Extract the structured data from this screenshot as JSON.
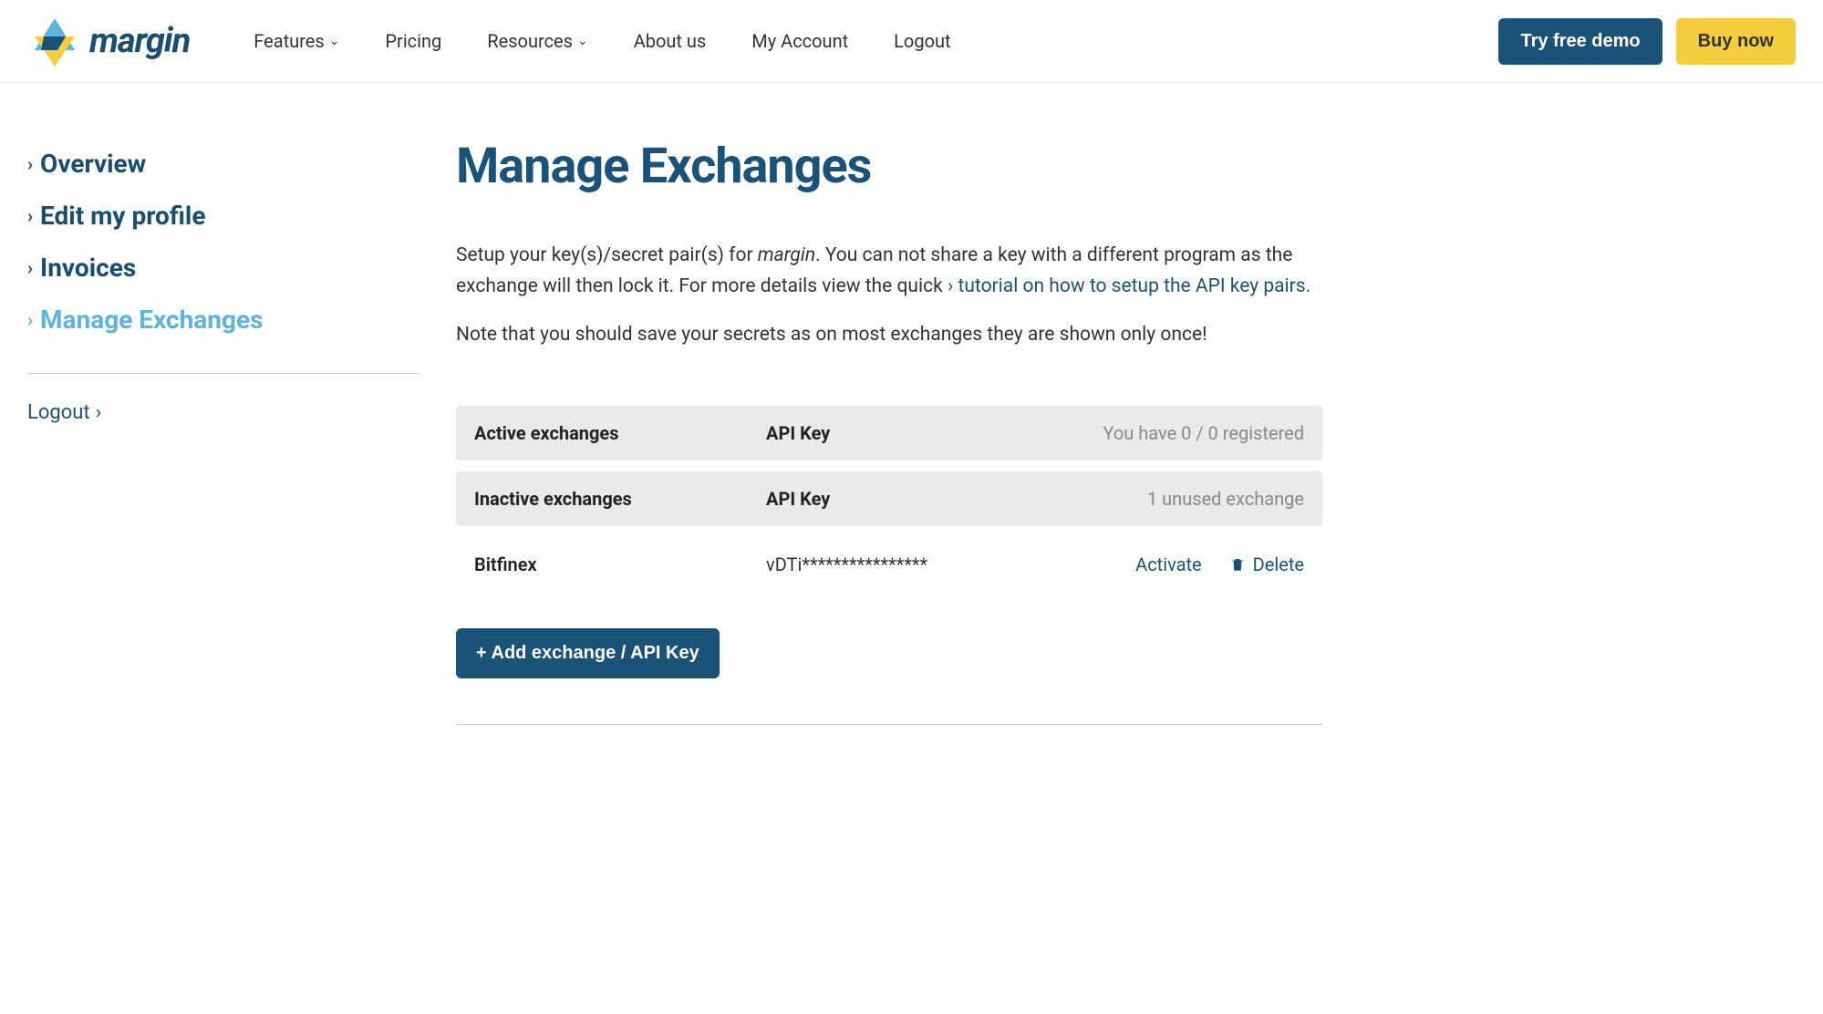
{
  "header": {
    "logo_text": "margin",
    "nav": {
      "features": "Features",
      "pricing": "Pricing",
      "resources": "Resources",
      "about": "About us",
      "account": "My Account",
      "logout": "Logout"
    },
    "demo_button": "Try free demo",
    "buy_button": "Buy now"
  },
  "sidebar": {
    "overview": "Overview",
    "edit_profile": "Edit my profile",
    "invoices": "Invoices",
    "manage_exchanges": "Manage Exchanges",
    "logout": "Logout"
  },
  "main": {
    "title": "Manage Exchanges",
    "intro_p1_a": "Setup your key(s)/secret pair(s) for ",
    "intro_p1_em": "margin",
    "intro_p1_b": ". You can not share a key with a different program as the exchange will then lock it. For more details view the quick ",
    "tutorial_chevron": "›",
    "tutorial_link": "tutorial on how to setup the API key pairs.",
    "note": "Note that you should save your secrets as on most exchanges they are shown only once!",
    "active": {
      "header": "Active exchanges",
      "api_key": "API Key",
      "status": "You have 0 / 0 registered"
    },
    "inactive": {
      "header": "Inactive exchanges",
      "api_key": "API Key",
      "status": "1 unused exchange"
    },
    "rows": [
      {
        "name": "Bitfinex",
        "key": "vDTi****************",
        "activate": "Activate",
        "delete": "Delete"
      }
    ],
    "add_button": "+ Add exchange / API Key"
  }
}
